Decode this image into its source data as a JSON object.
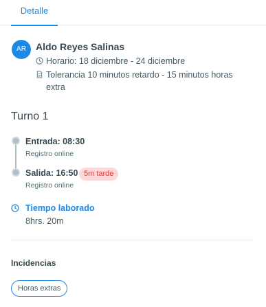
{
  "tabs": {
    "active_label": "Detalle"
  },
  "employee": {
    "initials": "AR",
    "name": "Aldo Reyes Salinas",
    "horario": "Horario: 18 diciembre - 24 diciembre",
    "tolerancia": "Tolerancia 10 minutos retardo - 15 minutos horas extra"
  },
  "turno": {
    "title": "Turno 1",
    "entrada": {
      "label": "Entrada: 08:30",
      "sub": "Registro online"
    },
    "salida": {
      "label": "Salida: 16:50",
      "sub": "Registro online",
      "badge": "5m tarde"
    },
    "tiempo_laborado": {
      "label": "Tiempo laborado",
      "value": "8hrs. 20m"
    }
  },
  "incidencias": {
    "title": "Incidencias",
    "chips": [
      "Horas extras"
    ]
  },
  "colors": {
    "accent": "#1e88e5",
    "late_bg": "#fdd8d8",
    "late_text": "#e53935"
  },
  "icons": {
    "horario": "clock-icon",
    "tolerancia": "document-icon",
    "tiempo": "clock-icon"
  }
}
